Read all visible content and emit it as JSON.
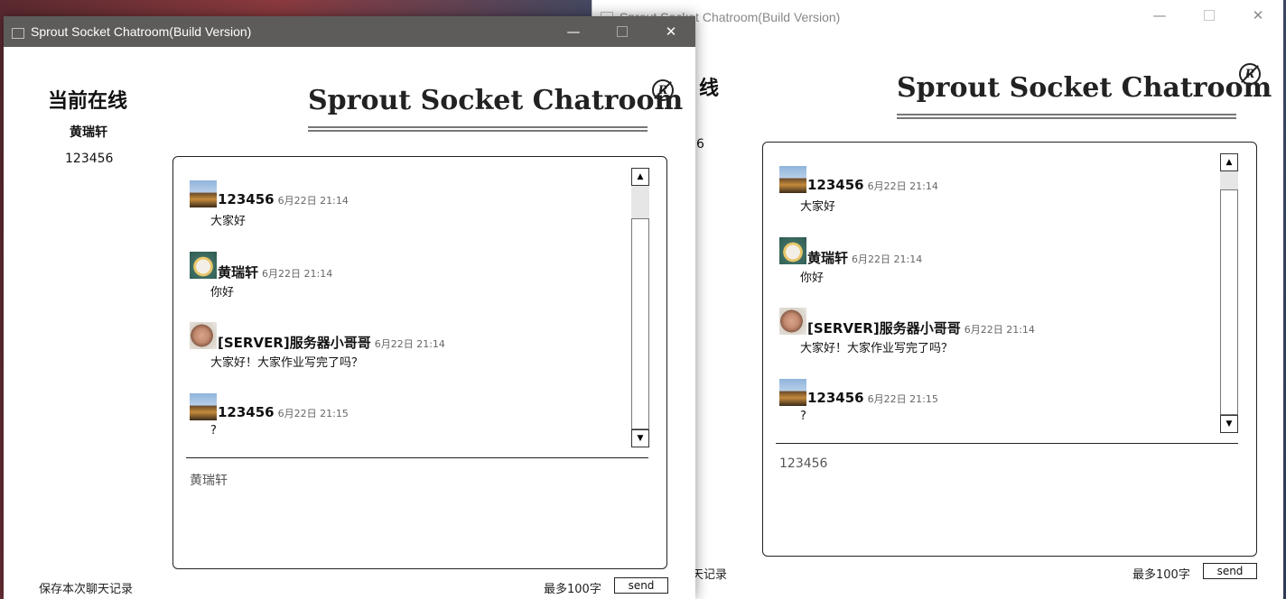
{
  "front": {
    "title": "Sprout Socket Chatroom(Build Version)",
    "controls": {
      "minimize": "—",
      "close": "✕"
    },
    "sidebar": {
      "heading": "当前在线",
      "users": [
        "黄瑞轩",
        "123456"
      ]
    },
    "app_title": "Sprout Socket Chatroom",
    "logo_letter": "R",
    "messages": [
      {
        "name": "123456",
        "time": "6月22日 21:14",
        "text": "大家好",
        "avatar": "cat-icon"
      },
      {
        "name": "黄瑞轩",
        "time": "6月22日 21:14",
        "text": "你好",
        "avatar": "girl-icon"
      },
      {
        "name": "[SERVER]服务器小哥哥",
        "time": "6月22日 21:14",
        "text": "大家好！大家作业写完了吗？",
        "avatar": "person-icon"
      },
      {
        "name": "123456",
        "time": "6月22日 21:15",
        "text": "?",
        "avatar": "cat-icon"
      }
    ],
    "input_value": "黄瑞轩",
    "save_label": "保存本次聊天记录",
    "limit_label": "最多100字",
    "send_label": "send"
  },
  "back": {
    "title": "Sprout Socket Chatroom(Build Version)",
    "controls": {
      "minimize": "—",
      "close": "✕"
    },
    "sidebar": {
      "heading_partial": "线",
      "user_partial": "6"
    },
    "app_title": "Sprout Socket Chatroom",
    "logo_letter": "R",
    "messages": [
      {
        "name": "123456",
        "time": "6月22日 21:14",
        "text": "大家好",
        "avatar": "cat-icon"
      },
      {
        "name": "黄瑞轩",
        "time": "6月22日 21:14",
        "text": "你好",
        "avatar": "girl-icon"
      },
      {
        "name": "[SERVER]服务器小哥哥",
        "time": "6月22日 21:14",
        "text": "大家好！大家作业写完了吗？",
        "avatar": "person-icon"
      },
      {
        "name": "123456",
        "time": "6月22日 21:15",
        "text": "?",
        "avatar": "cat-icon"
      }
    ],
    "input_value": "123456",
    "save_label_partial": "天记录",
    "limit_label": "最多100字",
    "send_label": "send"
  }
}
